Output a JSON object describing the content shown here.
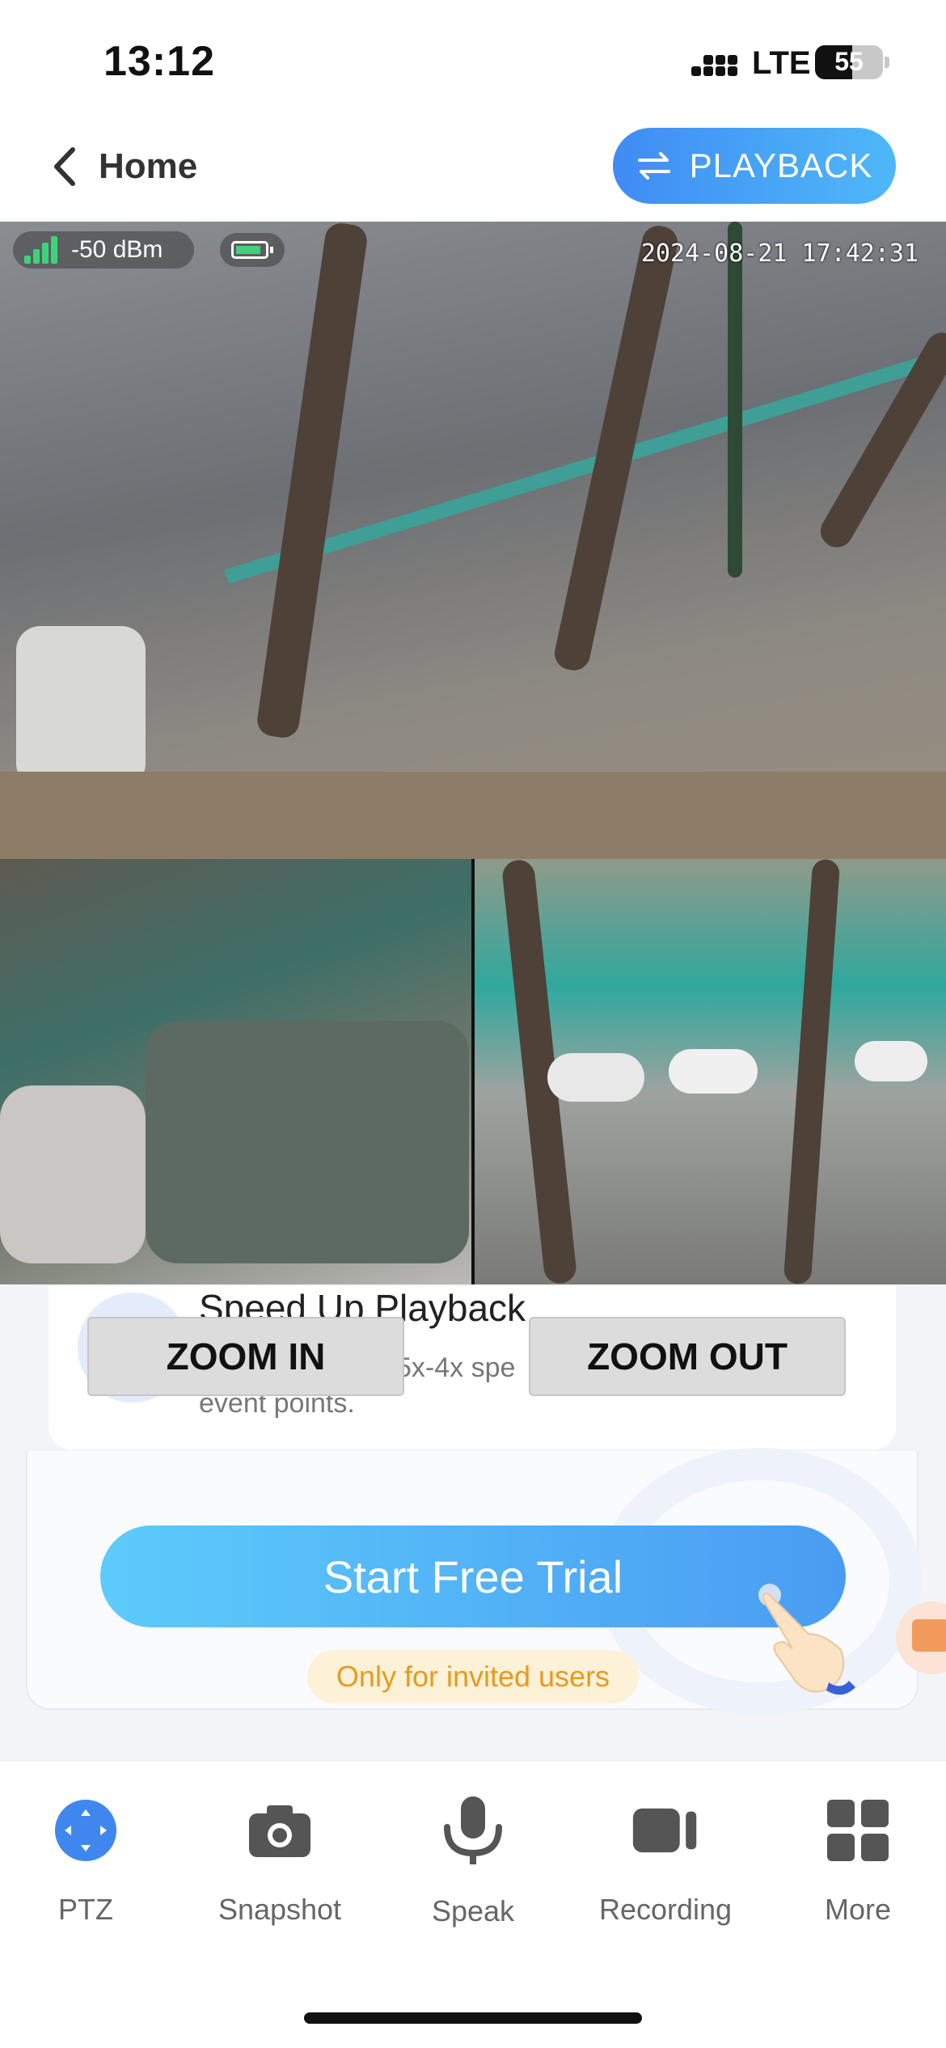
{
  "status_bar": {
    "time": "13:12",
    "network": "LTE",
    "battery": "55"
  },
  "header": {
    "back_label": "Home",
    "playback_label": "PLAYBACK"
  },
  "camera": {
    "signal": "-50 dBm",
    "timestamp": "2024-08-21 17:42:31"
  },
  "promo": {
    "title": "Speed Up Playback",
    "desc_line1": "5x-4x spe",
    "desc_line2": "event points."
  },
  "zoom": {
    "zoom_in_label": "ZOOM IN",
    "zoom_out_label": "ZOOM OUT"
  },
  "trial": {
    "button_label": "Start Free Trial",
    "invite_note": "Only for invited users"
  },
  "toolbar": {
    "items": [
      {
        "label": "PTZ",
        "icon": "ptz-icon"
      },
      {
        "label": "Snapshot",
        "icon": "camera-icon"
      },
      {
        "label": "Speak",
        "icon": "microphone-icon"
      },
      {
        "label": "Recording",
        "icon": "video-camera-icon"
      },
      {
        "label": "More",
        "icon": "grid-icon"
      }
    ]
  },
  "colors": {
    "accent": "#3f87ef",
    "trial_gradient_start": "#5ccbfb",
    "trial_gradient_end": "#4a9cf2",
    "invite_text": "#e89a1e"
  }
}
